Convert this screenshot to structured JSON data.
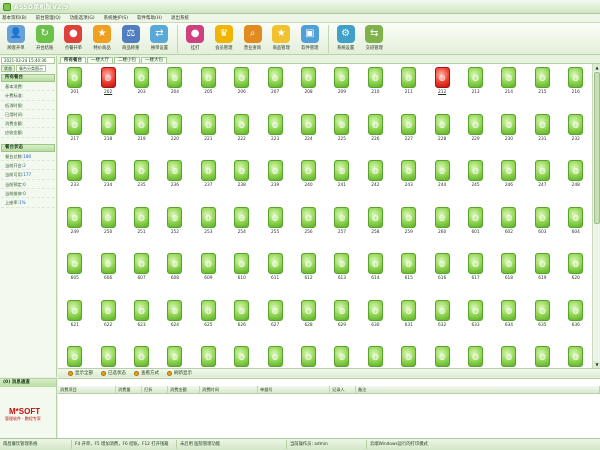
{
  "window": {
    "title": "ASSD单机版V2.9"
  },
  "menu": [
    "基本资料(B)",
    "前台管理(Q)",
    "功能选项(G)",
    "系统维护(S)",
    "软件帮助(H)",
    "退出系统"
  ],
  "toolbar": [
    {
      "label": "顾客开单",
      "icon": "person-icon",
      "color": "#6aa0d8",
      "glyph": "👤"
    },
    {
      "label": "开台结账",
      "icon": "checkout-icon",
      "color": "#6bc24a",
      "glyph": "↻"
    },
    {
      "label": "点餐开单",
      "icon": "food-icon",
      "color": "#e0403a",
      "glyph": "●"
    },
    {
      "label": "特价商品",
      "icon": "tag-icon",
      "color": "#f0a020",
      "glyph": "★"
    },
    {
      "label": "商品称重",
      "icon": "scale-icon",
      "color": "#4f7fbf",
      "glyph": "⚖"
    },
    {
      "label": "换单设置",
      "icon": "switch-icon",
      "color": "#58a8d8",
      "glyph": "⇄"
    },
    {
      "label": "挂打",
      "icon": "print-icon",
      "color": "#d04080",
      "glyph": "●"
    },
    {
      "label": "会员管理",
      "icon": "member-icon",
      "color": "#f1b400",
      "glyph": "♛"
    },
    {
      "label": "营业查询",
      "icon": "search-icon",
      "color": "#e08a20",
      "glyph": "⌕"
    },
    {
      "label": "商品管理",
      "icon": "goods-icon",
      "color": "#f2c12e",
      "glyph": "★"
    },
    {
      "label": "软件管理",
      "icon": "software-icon",
      "color": "#4f9fd8",
      "glyph": "▣"
    },
    {
      "label": "系统设置",
      "icon": "settings-icon",
      "color": "#40a0c8",
      "glyph": "⚙"
    },
    {
      "label": "交班管理",
      "icon": "shift-icon",
      "color": "#7fb34a",
      "glyph": "⇆"
    }
  ],
  "left": {
    "date": "2021-03-24 15:40:36",
    "subtabs": [
      "状态",
      "餐台分类图示"
    ],
    "section1": {
      "title": "所有餐台",
      "rows": [
        {
          "label": "基本消费:",
          "value": ""
        },
        {
          "label": "计费标准:",
          "value": ""
        },
        {
          "label": "低消时限:",
          "value": ""
        },
        {
          "label": "已用时间:",
          "value": ""
        },
        {
          "label": "消费金额:",
          "value": ""
        },
        {
          "label": "应收金额:",
          "value": ""
        }
      ]
    },
    "section2": {
      "title": "餐台状态",
      "rows": [
        {
          "label": "餐台总数:",
          "value": "180"
        },
        {
          "label": "当前开台:",
          "value": "2"
        },
        {
          "label": "当前可用:",
          "value": "177"
        },
        {
          "label": "当前预定:",
          "value": "0"
        },
        {
          "label": "当前维修:",
          "value": "0"
        },
        {
          "label": "上座率:",
          "value": "1%"
        }
      ]
    }
  },
  "main_tabs": [
    "所有餐台",
    "一楼大厅",
    "二楼小包",
    "一楼大包"
  ],
  "tables": [
    "201",
    "202",
    "203",
    "204",
    "205",
    "206",
    "207",
    "208",
    "209",
    "210",
    "211",
    "212",
    "213",
    "214",
    "215",
    "216",
    "217",
    "218",
    "219",
    "220",
    "221",
    "222",
    "223",
    "224",
    "225",
    "226",
    "227",
    "228",
    "229",
    "230",
    "231",
    "232",
    "233",
    "234",
    "235",
    "236",
    "237",
    "238",
    "239",
    "240",
    "241",
    "242",
    "243",
    "244",
    "245",
    "246",
    "247",
    "248",
    "249",
    "250",
    "251",
    "252",
    "253",
    "254",
    "255",
    "256",
    "257",
    "258",
    "259",
    "260",
    "601",
    "602",
    "603",
    "604",
    "605",
    "606",
    "607",
    "608",
    "609",
    "610",
    "611",
    "612",
    "613",
    "614",
    "615",
    "616",
    "617",
    "618",
    "619",
    "620",
    "621",
    "622",
    "623",
    "624",
    "625",
    "626",
    "627",
    "628",
    "629",
    "630",
    "631",
    "632",
    "633",
    "634",
    "635",
    "636",
    "637",
    "638",
    "639",
    "640",
    "641",
    "642",
    "643",
    "644",
    "645",
    "646",
    "647",
    "648",
    "649",
    "650",
    "651",
    "652"
  ],
  "occupied_tables": [
    "202",
    "212"
  ],
  "bottom_toolbar": [
    "显示全部",
    "已选状态",
    "查看方式",
    "刷新显示"
  ],
  "messages_title": "(0) 消息通道",
  "logo": {
    "brand": "M*SOFT",
    "sub": "管理软件 · 鹏程专家"
  },
  "detail_columns": [
    "消费项目",
    "消费量",
    "打折",
    "消费金额",
    "消费时间",
    "单据号",
    "记录人",
    "备注"
  ],
  "status": [
    "南昌餐饮管理系统",
    "F4 开单，F5 增加消费，F6 结账，F12 打开钱箱",
    "未启用 医院管理功能",
    "当前操作员: admin",
    "云端Windows运行的打印模式"
  ]
}
